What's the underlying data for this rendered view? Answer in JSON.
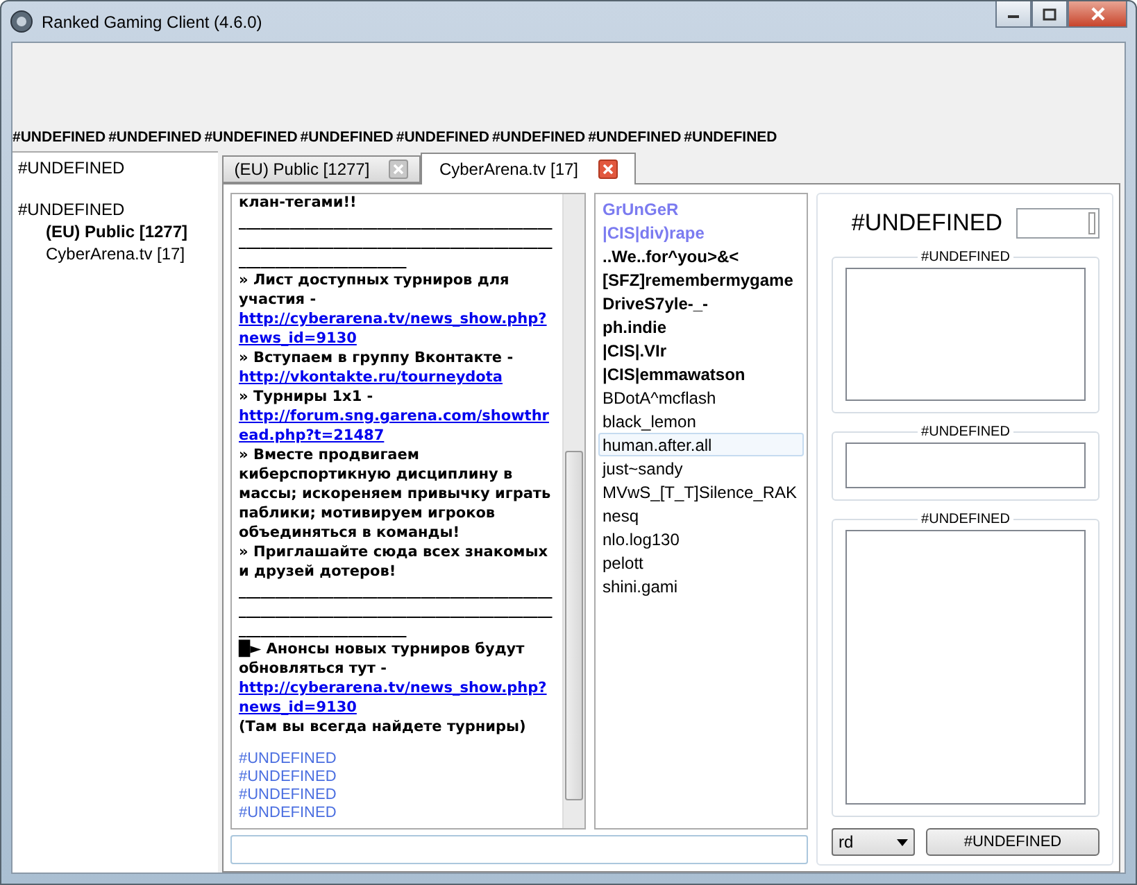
{
  "window": {
    "title": "Ranked Gaming Client (4.6.0)"
  },
  "menu": [
    "#UNDEFINED",
    "#UNDEFINED",
    "#UNDEFINED",
    "#UNDEFINED",
    "#UNDEFINED",
    "#UNDEFINED",
    "#UNDEFINED",
    "#UNDEFINED"
  ],
  "sidebar": {
    "items": [
      {
        "label": "#UNDEFINED"
      },
      {
        "label": "#UNDEFINED",
        "children": [
          {
            "label": "(EU) Public [1277]",
            "unread": true
          },
          {
            "label": "CyberArena.tv [17]",
            "unread": false
          }
        ]
      }
    ]
  },
  "tabs": [
    {
      "label": "(EU) Public [1277]",
      "selected": false
    },
    {
      "label": "CyberArena.tv [17]",
      "selected": true
    }
  ],
  "chat": {
    "messages": [
      {
        "parts": [
          {
            "kind": "text",
            "text": "клан-тегами!!"
          }
        ]
      },
      {
        "parts": [
          {
            "kind": "text",
            "text": "_____________________________________________________________________________________________________________"
          }
        ]
      },
      {
        "parts": [
          {
            "kind": "text",
            "text": "» Лист доступных турниров для участия - "
          },
          {
            "kind": "link",
            "text": "http://cyberarena.tv/news_show.php?news_id=9130"
          }
        ]
      },
      {
        "parts": [
          {
            "kind": "text",
            "text": "» Вступаем в группу Вконтакте - "
          },
          {
            "kind": "link",
            "text": "http://vkontakte.ru/tourneydota"
          }
        ]
      },
      {
        "parts": [
          {
            "kind": "text",
            "text": "» Турниры 1x1 - "
          },
          {
            "kind": "link",
            "text": "http://forum.sng.garena.com/showthread.php?t=21487"
          }
        ]
      },
      {
        "parts": [
          {
            "kind": "text",
            "text": "» Вместе продвигаем киберспортикную дисциплину в массы; искореняем привычку играть паблики; мотивируем игроков объединяться в команды!"
          }
        ]
      },
      {
        "parts": [
          {
            "kind": "text",
            "text": "» Приглашайте сюда всех знакомых и друзей дотеров!"
          }
        ]
      },
      {
        "parts": [
          {
            "kind": "text",
            "text": "_____________________________________________________________________________________________________________"
          }
        ]
      },
      {
        "parts": [
          {
            "kind": "text",
            "text": "█► Анонсы новых турниров будут обновляться тут - "
          },
          {
            "kind": "link",
            "text": "http://cyberarena.tv/news_show.php?news_id=9130"
          },
          {
            "kind": "text",
            "text": " (Там вы всегда найдете турниры)"
          }
        ]
      }
    ],
    "system_lines": [
      "#UNDEFINED",
      "#UNDEFINED",
      "#UNDEFINED",
      "#UNDEFINED"
    ]
  },
  "users": [
    {
      "name": "GrUnGeR",
      "kind": "admin",
      "selected": false
    },
    {
      "name": "|CIS|div)rape",
      "kind": "admin",
      "selected": false
    },
    {
      "name": "..We..for^you>&<",
      "kind": "vip",
      "selected": false
    },
    {
      "name": "[SFZ]remembermygame",
      "kind": "vip",
      "selected": false
    },
    {
      "name": "DriveS7yle-_-",
      "kind": "vip",
      "selected": false
    },
    {
      "name": "ph.indie",
      "kind": "vip",
      "selected": false
    },
    {
      "name": "|CIS|.VIr",
      "kind": "vip",
      "selected": false
    },
    {
      "name": "|CIS|emmawatson",
      "kind": "vip",
      "selected": false
    },
    {
      "name": "BDotA^mcflash",
      "kind": "normal",
      "selected": false
    },
    {
      "name": "black_lemon",
      "kind": "normal",
      "selected": false
    },
    {
      "name": "human.after.all",
      "kind": "normal",
      "selected": true
    },
    {
      "name": "just~sandy",
      "kind": "normal",
      "selected": false
    },
    {
      "name": "MVwS_[T_T]Silence_RAK",
      "kind": "normal",
      "selected": false
    },
    {
      "name": "nesq",
      "kind": "normal",
      "selected": false
    },
    {
      "name": "nlo.log130",
      "kind": "normal",
      "selected": false
    },
    {
      "name": "pelott",
      "kind": "normal",
      "selected": false
    },
    {
      "name": "shini.gami",
      "kind": "normal",
      "selected": false
    }
  ],
  "right_panel": {
    "heading": "#UNDEFINED",
    "groups": [
      {
        "title": "#UNDEFINED"
      },
      {
        "title": "#UNDEFINED"
      },
      {
        "title": "#UNDEFINED"
      }
    ],
    "dropdown": {
      "value": "rd"
    },
    "button": "#UNDEFINED"
  }
}
